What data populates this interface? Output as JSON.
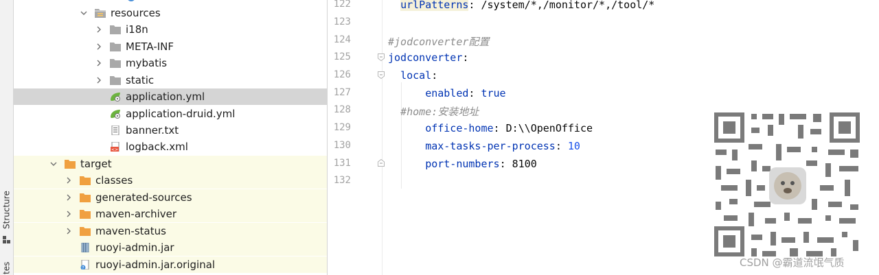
{
  "side_tabs": {
    "structure": "Structure",
    "bottom": "tes"
  },
  "project_tree": [
    {
      "label": "resources",
      "icon": "folder-icon",
      "expanded": true
    },
    {
      "label": "i18n",
      "icon": "folder-icon",
      "expanded": false
    },
    {
      "label": "META-INF",
      "icon": "folder-icon",
      "expanded": false
    },
    {
      "label": "mybatis",
      "icon": "folder-icon",
      "expanded": false
    },
    {
      "label": "static",
      "icon": "folder-icon",
      "expanded": false
    },
    {
      "label": "application.yml",
      "icon": "spring-yaml-icon",
      "selected": true
    },
    {
      "label": "application-druid.yml",
      "icon": "spring-yaml-icon"
    },
    {
      "label": "banner.txt",
      "icon": "text-file-icon"
    },
    {
      "label": "logback.xml",
      "icon": "xml-file-icon"
    },
    {
      "label": "target",
      "icon": "orange-folder-icon",
      "expanded": true
    },
    {
      "label": "classes",
      "icon": "orange-folder-icon",
      "expanded": false
    },
    {
      "label": "generated-sources",
      "icon": "orange-folder-icon",
      "expanded": false
    },
    {
      "label": "maven-archiver",
      "icon": "orange-folder-icon",
      "expanded": false
    },
    {
      "label": "maven-status",
      "icon": "orange-folder-icon",
      "expanded": false
    },
    {
      "label": "ruoyi-admin.jar",
      "icon": "jar-file-icon"
    },
    {
      "label": "ruoyi-admin.jar.original",
      "icon": "unknown-file-icon"
    }
  ],
  "editor": {
    "line_numbers": [
      "122",
      "123",
      "124",
      "125",
      "126",
      "127",
      "128",
      "129",
      "130",
      "131",
      "132"
    ],
    "lines": {
      "l122": {
        "key": "urlPatterns",
        "sep": ": ",
        "value": "/system/*,/monitor/*,/tool/*"
      },
      "l124": {
        "comment": "#jodconverter配置"
      },
      "l125": {
        "key": "jodconverter",
        "sep": ":"
      },
      "l126": {
        "key": "local",
        "sep": ":"
      },
      "l127": {
        "key": "enabled",
        "sep": ": ",
        "value": "true"
      },
      "l128": {
        "comment": "#home:安装地址"
      },
      "l129": {
        "key": "office-home",
        "sep": ": ",
        "value": "D:\\\\OpenOffice"
      },
      "l130": {
        "key": "max-tasks-per-process",
        "sep": ": ",
        "value": "10"
      },
      "l131": {
        "key": "port-numbers",
        "sep": ": ",
        "value": "8100"
      }
    }
  },
  "watermark": "CSDN @霸道流氓气质",
  "colors": {
    "key": "#0033b3",
    "number": "#1750eb",
    "comment": "#8c8c8c",
    "selected_row": "#d5d5d5",
    "excluded_bg": "#fbfbe6",
    "folder_gray": "#a9a9a9",
    "folder_orange": "#f0a040"
  }
}
